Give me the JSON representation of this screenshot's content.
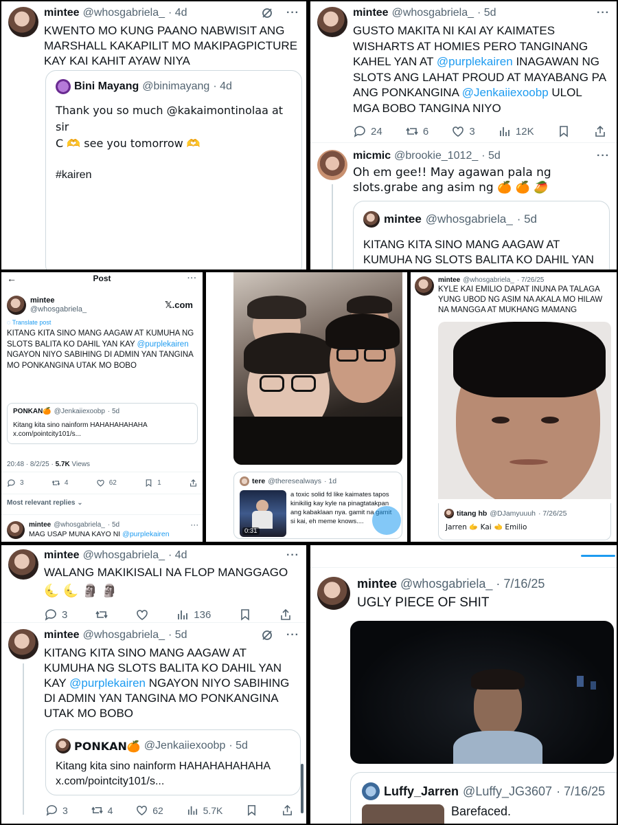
{
  "p1": {
    "name": "mintee",
    "handle": "@whosgabriela_",
    "time": "· 4d",
    "text": "KWENTO MO KUNG PAANO NABWISIT ANG MARSHALL KAKAPILIT MO MAKIPAGPICTURE KAY KAI KAHIT AYAW NIYA",
    "quote": {
      "name": "Bini Mayang",
      "handle": "@binimayang",
      "time": "· 4d",
      "line1": "Thank you so much @kakaimontinolaa  at sir",
      "line2": "C 🫶 see you tomorrow 🫶",
      "tag": "#kairen"
    }
  },
  "p2": {
    "name": "mintee",
    "handle": "@whosgabriela_",
    "time": "· 5d",
    "text_a": "GUSTO MAKITA NI KAI AY KAIMATES WISHARTS AT HOMIES PERO TANGINANG KAHEL YAN AT ",
    "mention_a": "@purplekairen",
    "text_b": " INAGAWAN NG SLOTS ANG LAHAT PROUD AT MAYABANG PA ANG PONKANGINA ",
    "mention_b": "@Jenkaiiexoobp",
    "text_c": " ULOL MGA BOBO TANGINA NIYO",
    "replies": "24",
    "reposts": "6",
    "likes": "3",
    "views": "12K",
    "reply": {
      "name": "micmic",
      "handle": "@brookie_1012_",
      "time": "· 5d",
      "text": "Oh em gee!! May agawan pala ng slots.grabe ang asim ng 🍊 🍊 🥭",
      "quote_name": "mintee",
      "quote_handle": "@whosgabriela_",
      "quote_time": "· 5d",
      "quote_text": "KITANG KITA SINO MANG AAGAW AT KUMUHA NG SLOTS BALITA KO DAHIL YAN KAY @purplekairen NGAYON NIYO"
    }
  },
  "p3": {
    "header": "Post",
    "name": "mintee",
    "handle": "@whosgabriela_",
    "brand": "𝕏.com",
    "translate": "Translate post",
    "text_a": "KITANG KITA SINO MANG AAGAW AT KUMUHA NG SLOTS BALITA KO DAHIL YAN KAY ",
    "mention": "@purplekairen",
    "text_b": " NGAYON NIYO SABIHING DI ADMIN YAN TANGINA MO PONKANGINA UTAK MO BOBO",
    "quote_name": "PONKAN🍊",
    "quote_handle": "@Jenkaiiexoobp",
    "quote_time": "· 5d",
    "quote_text": "Kitang kita sino nainform HAHAHAHAHAHA x.com/pointcity101/s...",
    "timestamp": "20:48 · 8/2/25 · ",
    "views_num": "5.7K",
    "views_label": " Views",
    "replies": "3",
    "reposts": "4",
    "likes": "62",
    "bookmarks": "1",
    "sort": "Most relevant replies",
    "next_name": "mintee",
    "next_handle": "@whosgabriela_",
    "next_time": "· 5d",
    "next_text": "MAG USAP MUNA KAYO NI ",
    "next_mention": "@purplekairen"
  },
  "p4": {
    "name": "tere",
    "handle": "@theresealways",
    "time": "· 1d",
    "text": "a toxic solid fd like kaimates tapos kinikilig kay kyle na pinagtatakpan ang kabaklaan nya. gamit na gamit si kai, eh meme knows....",
    "video_time": "0:31"
  },
  "p5": {
    "name": "mintee",
    "handle": "@whosgabriela_",
    "time": "· 7/26/25",
    "text": "KYLE KAI EMILIO DAPAT INUNA PA TALAGA YUNG UBOD NG ASIM NA AKALA MO HILAW NA MANGGA AT MUKHANG MAMANG",
    "quote_name": "titang hb",
    "quote_handle": "@DJamyuuuh",
    "quote_time": "· 7/26/25",
    "quote_text": "Jarren 🫱 Kai 🫲 Emilio"
  },
  "p6": {
    "name": "mintee",
    "handle": "@whosgabriela_",
    "time": "· 4d",
    "text": "WALANG MAKIKISALI NA FLOP MANGGAGO",
    "emoji": "🌜 🌜 🗿 🗿",
    "replies": "3",
    "views": "136"
  },
  "p7": {
    "name": "mintee",
    "handle": "@whosgabriela_",
    "time": "· 5d",
    "text_a": "KITANG KITA SINO MANG AAGAW AT KUMUHA NG SLOTS BALITA KO DAHIL YAN KAY ",
    "mention": "@purplekairen",
    "text_b": " NGAYON NIYO SABIHING DI ADMIN YAN TANGINA MO PONKANGINA UTAK MO BOBO",
    "quote_name": "PONKAN🍊",
    "quote_handle": "@Jenkaiiexoobp",
    "quote_time": "· 5d",
    "quote_line1": "Kitang kita sino nainform HAHAHAHAHAHA",
    "quote_line2": "x.com/pointcity101/s...",
    "replies": "3",
    "reposts": "4",
    "likes": "62",
    "views": "5.7K"
  },
  "p8": {
    "name": "mintee",
    "handle": "@whosgabriela_",
    "time": "· 7/16/25",
    "text": "UGLY PIECE OF SHIT",
    "quote_name": "Luffy_Jarren",
    "quote_handle": "@Luffy_JG3607",
    "quote_time": "· 7/16/25",
    "quote_text": "Barefaced."
  },
  "colors": {
    "link": "#1d9bf0",
    "muted": "#536471",
    "border": "#cfd9de"
  }
}
